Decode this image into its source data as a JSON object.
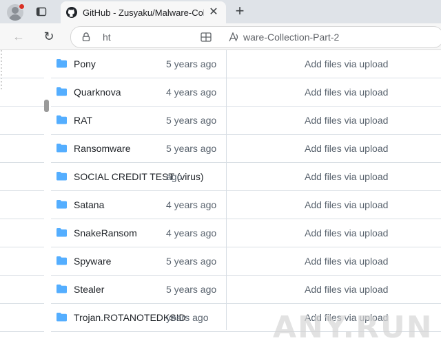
{
  "tab": {
    "title": "GitHub - Zusyaku/Malware-Collec",
    "close_glyph": "✕",
    "newtab_glyph": "+"
  },
  "toolbar": {
    "url_start": "ht",
    "url_end": "ware-Collection-Part-2",
    "back_glyph": "←",
    "reload_glyph": "↻"
  },
  "files": [
    {
      "name": "Pony",
      "age": "5 years ago",
      "commit": "Add files via upload"
    },
    {
      "name": "Quarknova",
      "age": "4 years ago",
      "commit": "Add files via upload"
    },
    {
      "name": "RAT",
      "age": "5 years ago",
      "commit": "Add files via upload"
    },
    {
      "name": "Ransomware",
      "age": "5 years ago",
      "commit": "Add files via upload"
    },
    {
      "name": "SOCIAL CREDIT TEST (virus)",
      "age": "ago",
      "commit": "Add files via upload"
    },
    {
      "name": "Satana",
      "age": "4 years ago",
      "commit": "Add files via upload"
    },
    {
      "name": "SnakeRansom",
      "age": "4 years ago",
      "commit": "Add files via upload"
    },
    {
      "name": "Spyware",
      "age": "5 years ago",
      "commit": "Add files via upload"
    },
    {
      "name": "Stealer",
      "age": "5 years ago",
      "commit": "Add files via upload"
    },
    {
      "name": "Trojan.ROTANOTEDKSID",
      "age": "years ago",
      "commit": "Add files via upload"
    }
  ],
  "watermark": "ANY.RUN",
  "colors": {
    "folder": "#54aeff",
    "text": "#1f2328",
    "muted": "#59636e",
    "border": "#d8dee4"
  }
}
